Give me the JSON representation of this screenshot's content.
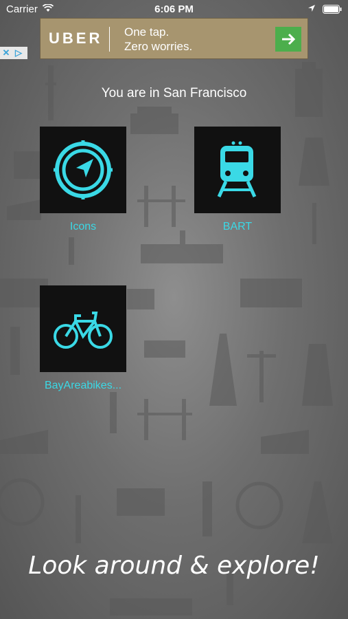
{
  "status": {
    "carrier": "Carrier",
    "time": "6:06 PM"
  },
  "ad": {
    "brand": "UBER",
    "line1": "One tap.",
    "line2": "Zero worries."
  },
  "location_text": "You are in San Francisco",
  "tiles": [
    {
      "label": "Icons",
      "icon": "compass-icon"
    },
    {
      "label": "BART",
      "icon": "train-icon"
    },
    {
      "label": "BayAreabikes...",
      "icon": "bicycle-icon"
    }
  ],
  "tagline": "Look around & explore!",
  "colors": {
    "accent": "#3ad9e6",
    "tile_bg": "#111111",
    "ad_bg": "#a7956f",
    "ad_button": "#4cae4c"
  }
}
